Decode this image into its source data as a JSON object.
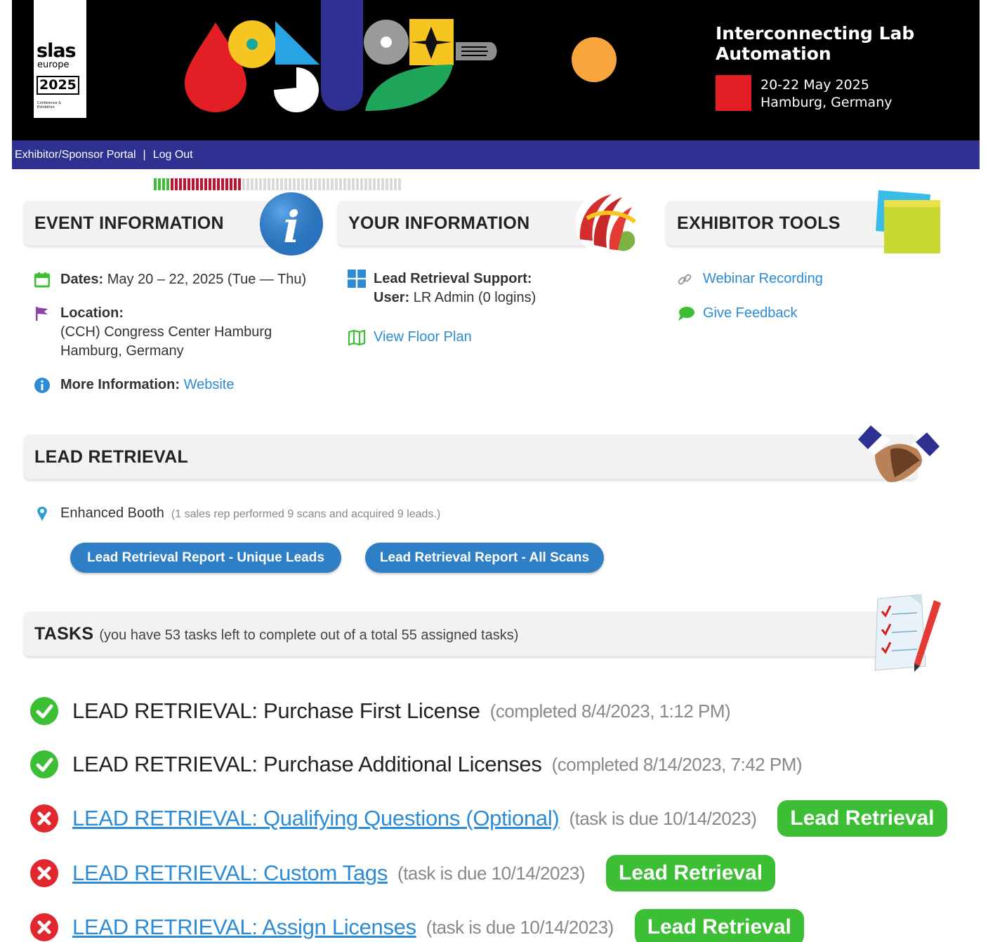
{
  "banner": {
    "logo_slas": "slas",
    "logo_europe": "europe",
    "logo_year": "2025",
    "logo_conf": "Conference & Exhibition",
    "title": "Interconnecting Lab Automation",
    "dates": "20-22 May 2025",
    "city": "Hamburg, Germany"
  },
  "nav": {
    "portal": "Exhibitor/Sponsor Portal",
    "separator": "|",
    "logout": "Log Out"
  },
  "progress": {
    "completed_tasks": 2,
    "total_tasks": 55
  },
  "event_info": {
    "header": "EVENT INFORMATION",
    "dates_label": "Dates:",
    "dates_value": "May 20 – 22, 2025 (Tue — Thu)",
    "location_label": "Location:",
    "location_line1": "(CCH) Congress Center Hamburg",
    "location_line2": "Hamburg, Germany",
    "more_label": "More Information:",
    "more_link": "Website"
  },
  "your_info": {
    "header": "YOUR INFORMATION",
    "support_label": "Lead Retrieval Support:",
    "user_label": "User:",
    "user_value": "LR Admin (0 logins)",
    "floor_plan": "View Floor Plan"
  },
  "exhibitor_tools": {
    "header": "EXHIBITOR TOOLS",
    "webinar": "Webinar Recording",
    "feedback": "Give Feedback"
  },
  "lead_retrieval": {
    "header": "LEAD RETRIEVAL",
    "package": "Enhanced Booth",
    "note": "(1 sales rep performed 9 scans and acquired 9 leads.)",
    "btn_unique": "Lead Retrieval Report - Unique Leads",
    "btn_all": "Lead Retrieval Report - All Scans"
  },
  "tasks": {
    "header": "TASKS",
    "summary": "(you have 53 tasks left to complete out of a total 55 assigned tasks)",
    "items": [
      {
        "title": "LEAD RETRIEVAL: Purchase First License",
        "status": "(completed 8/4/2023, 1:12 PM)",
        "done": true
      },
      {
        "title": "LEAD RETRIEVAL: Purchase Additional Licenses",
        "status": "(completed 8/14/2023, 7:42 PM)",
        "done": true
      },
      {
        "title": "LEAD RETRIEVAL: Qualifying Questions (Optional)",
        "status": "(task is due 10/14/2023)",
        "done": false,
        "button": "Lead Retrieval"
      },
      {
        "title": "LEAD RETRIEVAL: Custom Tags",
        "status": "(task is due 10/14/2023)",
        "done": false,
        "button": "Lead Retrieval"
      },
      {
        "title": "LEAD RETRIEVAL: Assign Licenses",
        "status": "(task is due 10/14/2023)",
        "done": false,
        "button": "Lead Retrieval"
      }
    ]
  },
  "colors": {
    "nav_bg": "#2e3192",
    "link": "#2c8bd6",
    "success": "#3cbf35",
    "danger": "#e0282e",
    "button_blue": "#2f7fc7"
  }
}
